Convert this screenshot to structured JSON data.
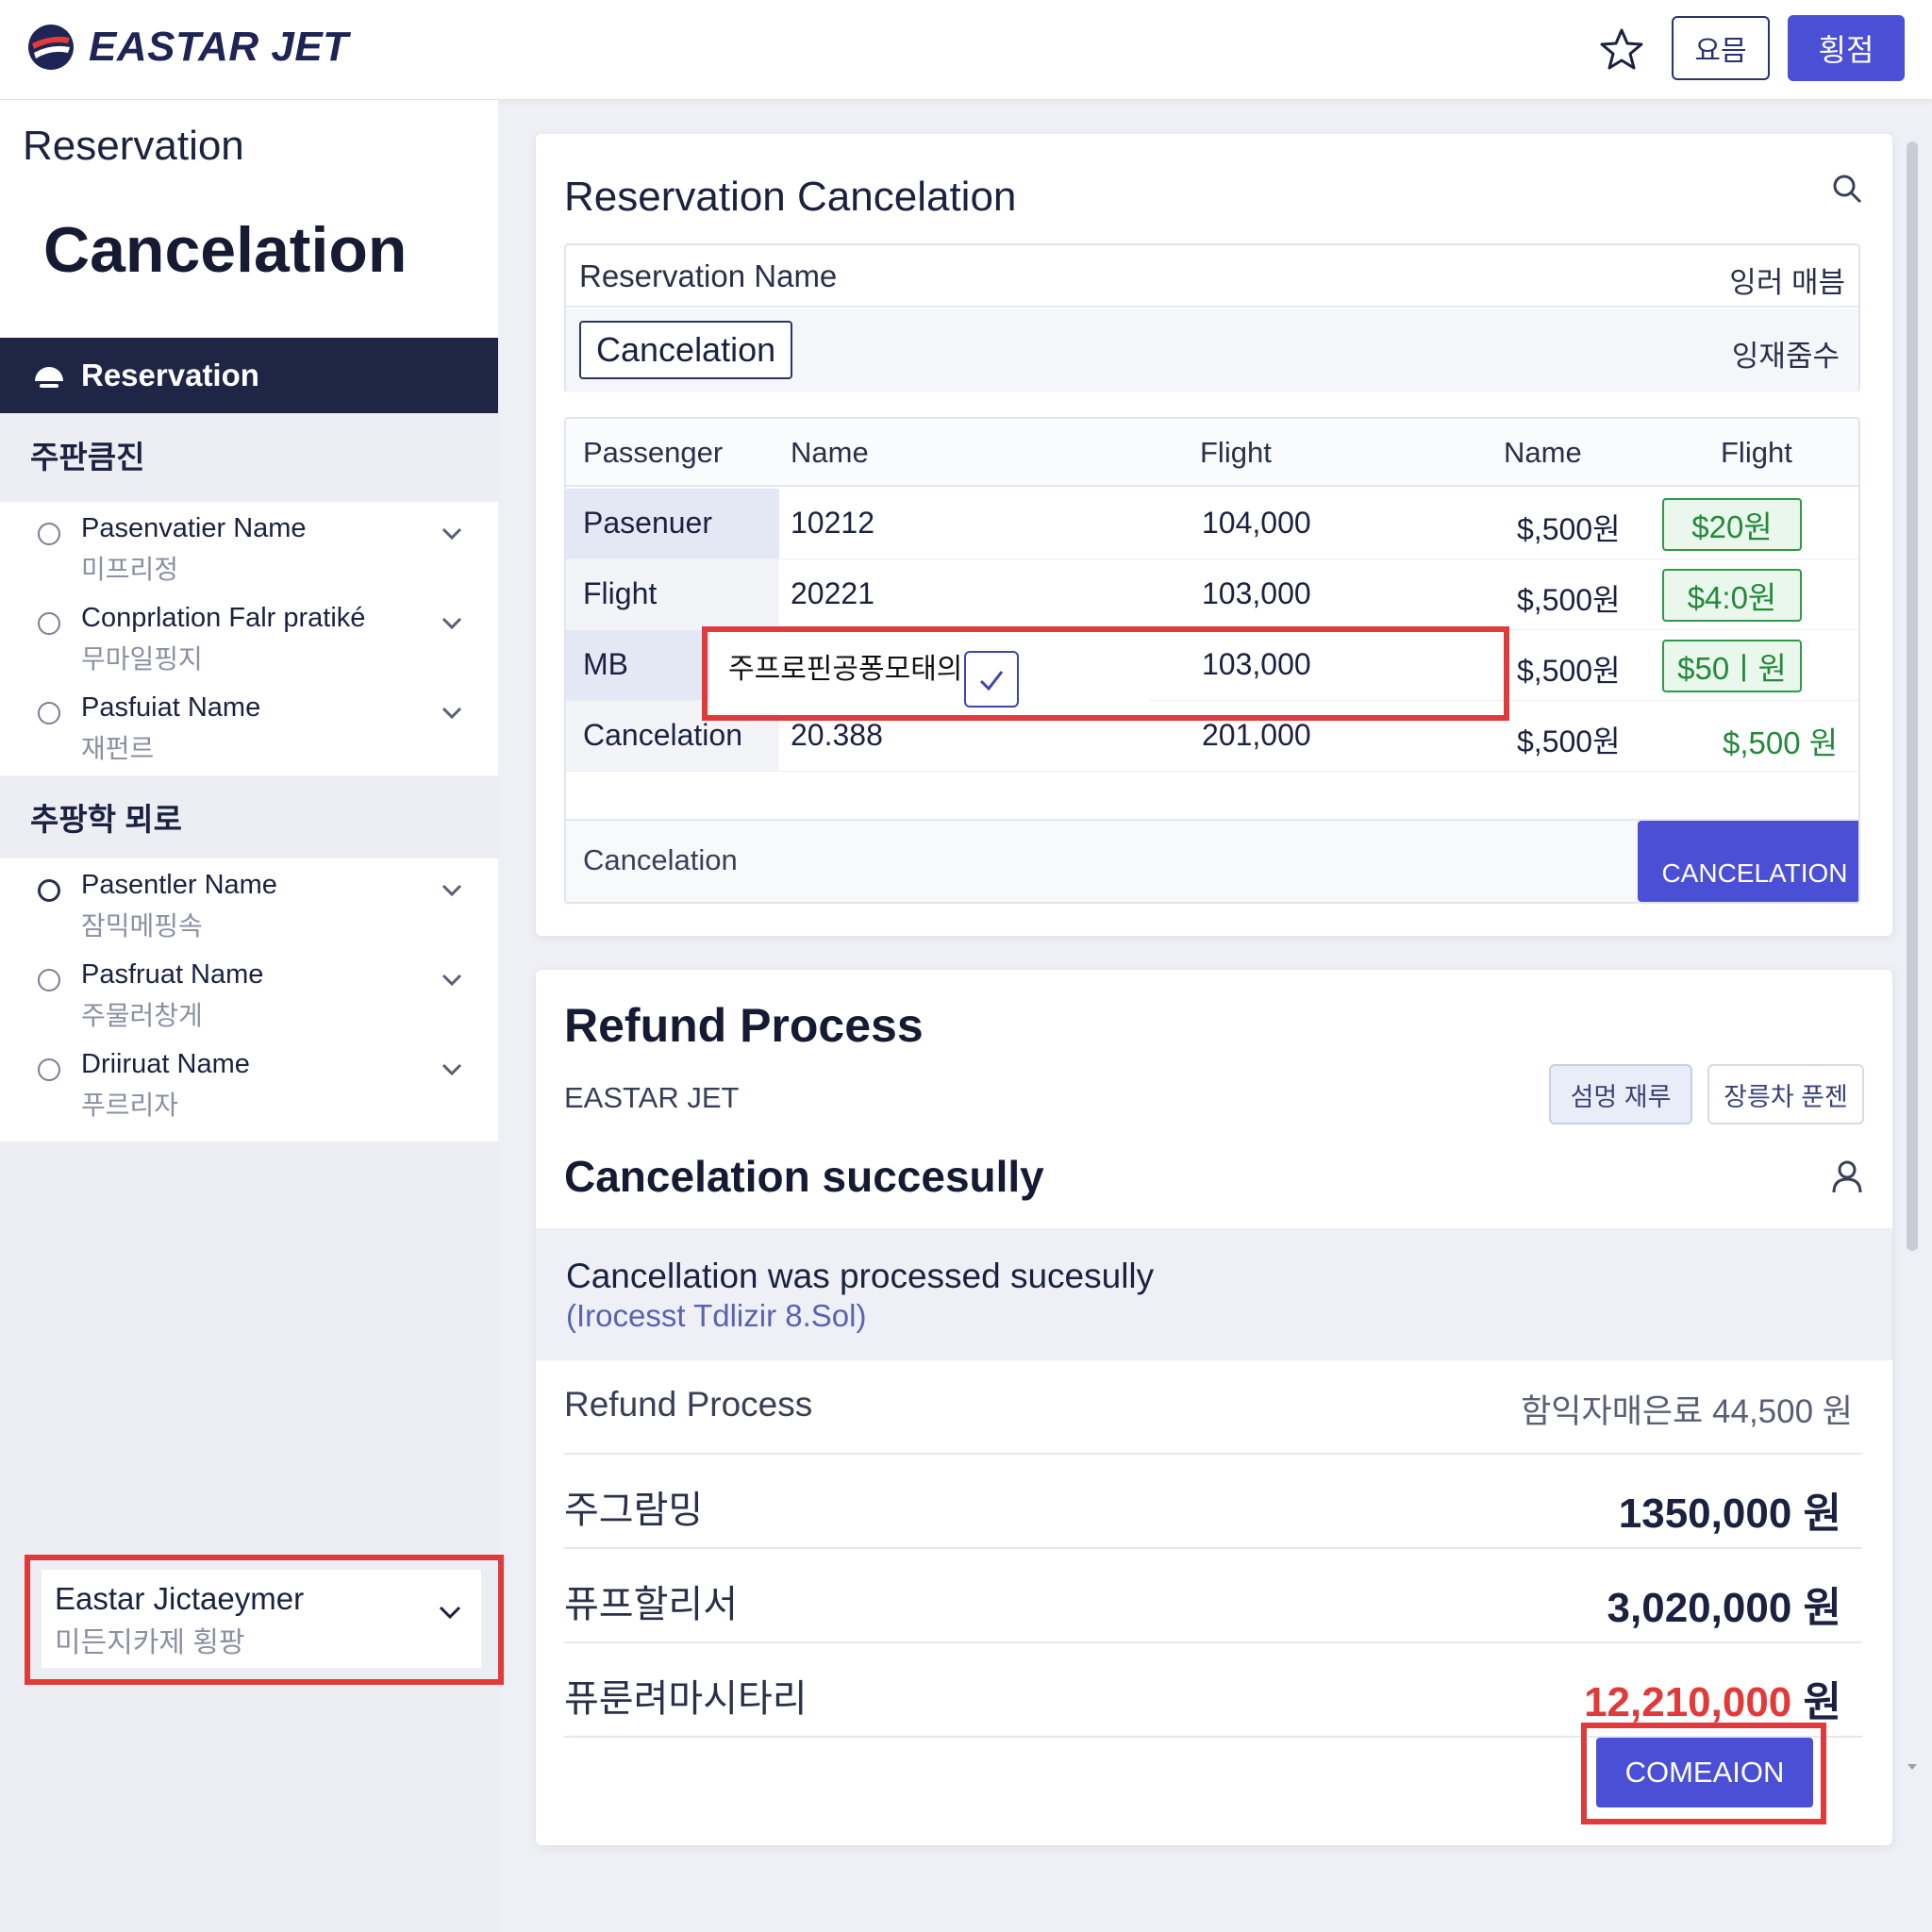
{
  "header": {
    "brand": "EASTAR JET",
    "button_outline": "요믐",
    "button_primary": "횡점",
    "icons": {
      "logo": "eastar-logo",
      "star": "star-icon"
    },
    "accent_color": "#4a4fd6"
  },
  "sidebar": {
    "subtitle": "Reservation",
    "title": "Cancelation",
    "active_item": "Reservation",
    "group1": {
      "label": "주판큼진",
      "items": [
        {
          "name": "Pasenvatier Name",
          "sub": "미프리정"
        },
        {
          "name": "Conprlation Falr pratiké",
          "sub": "무마일핑지"
        },
        {
          "name": "Pasfuiat Name",
          "sub": "재펀르"
        }
      ]
    },
    "group2": {
      "label": "추팡학 뫼로",
      "items": [
        {
          "name": "Pasentler Name",
          "sub": "잠믹메핑속"
        },
        {
          "name": "Pasfruat Name",
          "sub": "주물러창게"
        },
        {
          "name": "Driiruat Name",
          "sub": "푸르리자"
        }
      ]
    },
    "footer": {
      "name": "Eastar Jictaeymer",
      "sub": "미든지카제 횡팡"
    }
  },
  "reservation_card": {
    "title": "Reservation Cancelation",
    "name_panel": {
      "label": "Reservation Name",
      "label_right": "잉러 매븜",
      "chip": "Cancelation",
      "chip_right": "잉재줌수"
    },
    "table": {
      "headers": [
        "Passenger",
        "Name",
        "Flight",
        "Name",
        "Flight"
      ],
      "rows": [
        {
          "c1": "Pasenuer",
          "c2": "10212",
          "c3": "104,000",
          "c4": "$,500원",
          "c5": "$20원"
        },
        {
          "c1": "Flight",
          "c2": "20221",
          "c3": "103,000",
          "c4": "$,500원",
          "c5": "$4:0원"
        },
        {
          "c1": "MB",
          "c2": "",
          "c3": "103,000",
          "c4": "$,500원",
          "c5": "$50ㅣ원"
        },
        {
          "c1": "Cancelation",
          "c2": "20.388",
          "c3": "201,000",
          "c4": "$,500원",
          "c5": "$,500 원"
        }
      ],
      "overlay_text": "주프로핀공퐁모태의",
      "footer_label": "Cancelation",
      "cancel_button": "CANCELATION"
    }
  },
  "refund_card": {
    "title": "Refund Process",
    "brand": "EASTAR JET",
    "pill1": "섬멍 재루",
    "pill2": "장릉차 푼젠",
    "status_title": "Cancelation succesully",
    "notice": {
      "line1": "Cancellation was processed sucesully",
      "line2": "(Irocesst Tdlizir 8.Sol)"
    },
    "summary": [
      {
        "label": "Refund Process",
        "value": "함익자매은료 44,500 원"
      },
      {
        "label": "주그람밍",
        "value": "1350,000 원"
      },
      {
        "label": "퓨프할리서",
        "value": "3,020,000 원"
      },
      {
        "label": "퓨룬려마시타리",
        "value": "12,210,000",
        "unit": "원"
      }
    ],
    "confirm_button": "COMEAION",
    "highlight_color": "#e03a3a"
  }
}
